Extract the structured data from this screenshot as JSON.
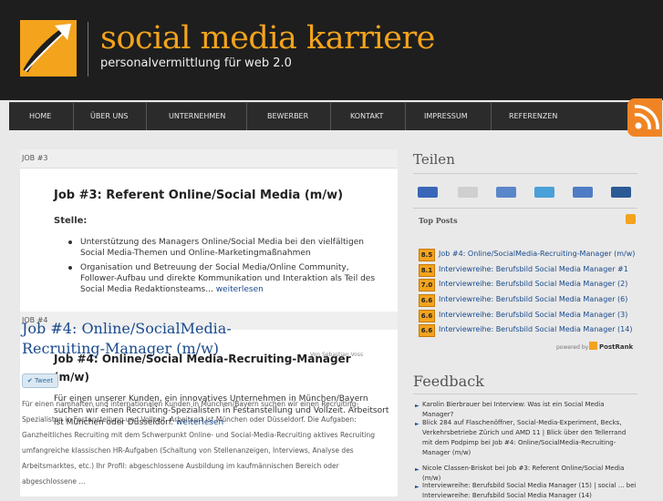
{
  "header": {
    "title": "social media karriere",
    "tagline": "personalvermittlung für web 2.0",
    "logo_icon": "rocket-arrow-icon",
    "brand_color": "#f3a31c"
  },
  "nav": {
    "items": [
      "HOME",
      "ÜBER UNS",
      "UNTERNEHMEN",
      "BEWERBER",
      "KONTAKT",
      "IMPRESSUM",
      "REFERENZEN"
    ],
    "rss_icon": "rss-feed-icon"
  },
  "main": {
    "job3": {
      "bar_label": "JOB #3",
      "title": "Job #3: Referent Online/Social Media (m/w)",
      "stelle_label": "Stelle:",
      "bullet1": "Unterstützung des Managers Online/Social Media bei den vielfältigen Social Media-Themen und Online-Marketingmaßnahmen",
      "bullet2": "Organisation und Betreuung der Social Media/Online Community, Follower-Aufbau und direkte Kommunikation und Interaktion als Teil des Social Media Redaktionsteams...",
      "read_more": "weiterlesen"
    },
    "job4": {
      "bar_label": "JOB #4",
      "overlay_title": "Job #4: Online/SocialMedia-Recruiting-Manager (m/w)",
      "title": "Job #4: Online/Social Media-Recruiting-Manager (m/w)",
      "author": "Von Sebastian Voss",
      "tweet_label": "Tweet",
      "text": "Für einen unserer Kunden, ein innovatives Unternehmen in München/Bayern suchen wir einen Recruiting-Spezialisten in Festanstellung und Vollzeit. Arbeitsort ist München oder Düsseldorf.",
      "read_more": "weiterlesen",
      "overlap_text": "Für einen namhaften und internationalen Kunden in München/Bayern suchen wir einen Recruiting-Spezialisten in Festanstellung und Vollzeit. Arbeitsort ist München oder Düsseldorf. Die Aufgaben: Ganzheitliches Recruiting mit dem Schwerpunkt Online- und Social-Media-Recruiting aktives Recruiting umfangreiche klassischen HR-Aufgaben (Schaltung von Stellenanzeigen, Interviews, Analyse des Arbeitsmarktes, etc.) Ihr Profil: abgeschlossene Ausbildung im kaufmännischen Bereich oder abgeschlossene ..."
    }
  },
  "sidebar": {
    "share_title": "Teilen",
    "share_icons": [
      "delicious-icon",
      "digg-icon",
      "mixx-icon",
      "stumbleupon-icon",
      "reddit-icon",
      "linkedin-icon"
    ],
    "top_posts_label": "Top Posts",
    "top_posts": [
      {
        "score": "8.5",
        "label": "Job #4: Online/SocialMedia-Recruiting-Manager (m/w)"
      },
      {
        "score": "8.1",
        "label": "Interviewreihe: Berufsbild Social Media Manager #1"
      },
      {
        "score": "7.0",
        "label": "Interviewreihe: Berufsbild Social Media Manager (2)"
      },
      {
        "score": "6.6",
        "label": "Interviewreihe: Berufsbild Social Media Manager (6)"
      },
      {
        "score": "6.6",
        "label": "Interviewreihe: Berufsbild Social Media Manager (3)"
      },
      {
        "score": "6.6",
        "label": "Interviewreihe: Berufsbild Social Media Manager (14)"
      }
    ],
    "powered_by": "powered by",
    "postrank": "PostRank",
    "feedback_title": "Feedback",
    "feedback": [
      "Karolin Bierbrauer bei Interview: Was ist ein Social Media Manager?",
      "Blick 284 auf Flaschenöffner, Social-Media-Experiment, Becks, Verkehrsbetriebe Zürich und AMD 11 | Blick über den Tellerrand mit dem Podpimp bei Job #4: Online/SocialMedia-Recruiting-Manager (m/w)",
      "Nicole Classen-Briskot bei Job #3: Referent Online/Social Media (m/w)",
      "Interviewreihe: Berufsbild Social Media Manager (15) | social ... bei Interviewreihe: Berufsbild Social Media Manager (14)"
    ]
  }
}
